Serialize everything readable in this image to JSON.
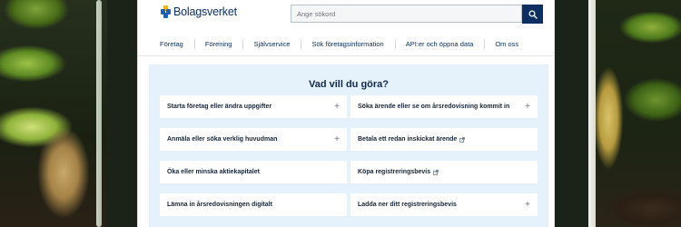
{
  "header": {
    "logo_text": "Bolagsverket",
    "search_placeholder": "Ange sökord",
    "search_button_icon": "search-icon",
    "brand_color": "#0c2f63"
  },
  "nav": {
    "items": [
      {
        "label": "Företag"
      },
      {
        "label": "Förening"
      },
      {
        "label": "Självservice"
      },
      {
        "label": "Sök företagsinformation"
      },
      {
        "label": "API:er och öppna data"
      },
      {
        "label": "Om oss"
      }
    ]
  },
  "main": {
    "title": "Vad vill du göra?",
    "cards": [
      {
        "label": "Starta företag eller ändra uppgifter",
        "icon": "plus-icon"
      },
      {
        "label": "Söka ärende eller se om årsredovisning kommit in",
        "icon": "plus-icon"
      },
      {
        "label": "Anmäla eller söka verklig huvudman",
        "icon": "plus-icon"
      },
      {
        "label": "Betala ett redan inskickat ärende",
        "icon": "external-link-icon"
      },
      {
        "label": "Öka eller minska aktiekapitalet",
        "icon": ""
      },
      {
        "label": "Köpa registreringsbevis",
        "icon": "external-link-icon"
      },
      {
        "label": "Lämna in årsredovisningen digitalt",
        "icon": ""
      },
      {
        "label": "Ladda ner ditt registreringsbevis",
        "icon": "plus-icon"
      }
    ],
    "panel_color": "#e6f2fb"
  }
}
